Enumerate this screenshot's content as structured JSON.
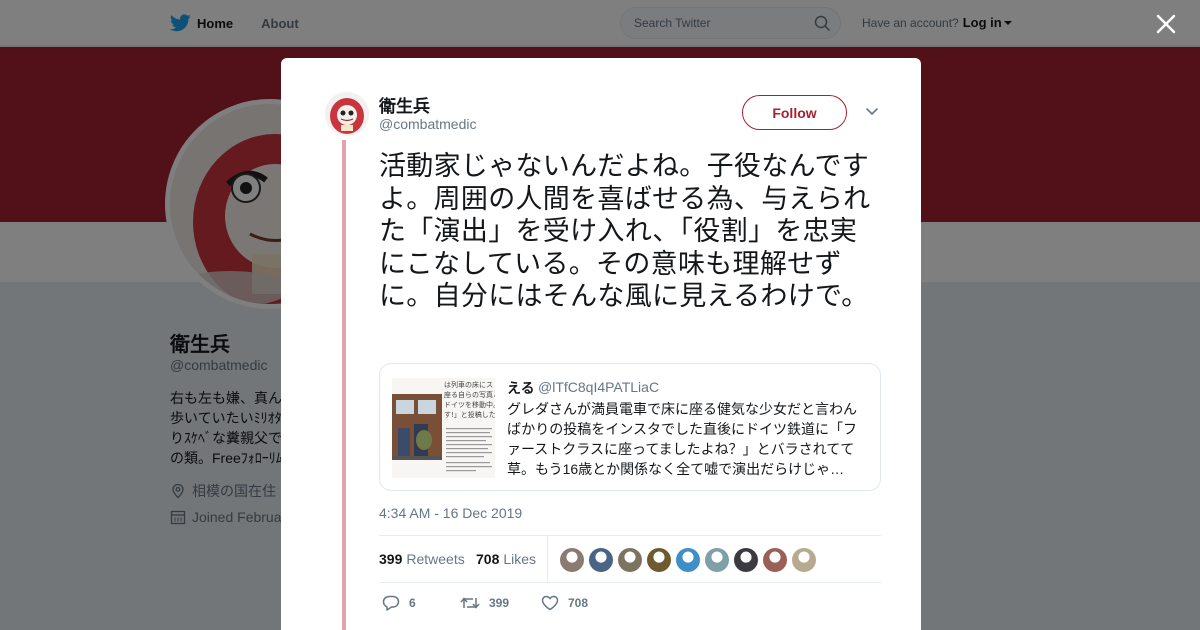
{
  "topbar": {
    "home_label": "Home",
    "about_label": "About",
    "search_placeholder": "Search Twitter",
    "have_account": "Have an account?",
    "login_label": "Log in"
  },
  "profile": {
    "name": "衛生兵",
    "handle": "@combatmedic",
    "bio_lines": [
      "右も左も嫌、真ん",
      "歩いていたいﾐﾘｵﾀ",
      "りｽｹﾍﾞな糞親父で",
      "の類。Freeﾌｫﾛｰﾘﾑ"
    ],
    "location": "相模の国在住",
    "joined": "Joined February"
  },
  "tweet": {
    "author_name": "衛生兵",
    "author_handle": "@combatmedic",
    "follow_label": "Follow",
    "text": "活動家じゃないんだよね。子役なんですよ。周囲の人間を喜ばせる為、与えられた「演出」を受け入れ、「役割」を忠実にこなしている。その意味も理解せずに。自分にはそんな風に見えるわけで。",
    "quoted": {
      "name": "える",
      "handle": "@lTfC8qI4PATLiaC",
      "text": "グレダさんが満員電車で床に座る健気な少女だと言わんばかりの投稿をインスタでした直後にドイツ鉄道に「ファーストクラスに座ってましたよね？」とバラされてて草。もう16歳とか関係なく全て嘘で演出だらけじゃ…",
      "image_text": [
        "は列車の床にス",
        "座る自らの写真と",
        "ドイツを移動中。",
        "す!」と投稿した"
      ]
    },
    "timestamp": "4:34 AM - 16 Dec 2019",
    "retweets_count": "399",
    "retweets_label": "Retweets",
    "likes_count": "708",
    "likes_label": "Likes",
    "likers_colors": [
      "#8a7a72",
      "#4a6486",
      "#7b7560",
      "#6e5a2e",
      "#3d8fc9",
      "#7fa0a8",
      "#3a3a40",
      "#9a6058",
      "#b8aa90"
    ],
    "reply_count": "6",
    "retweet_action_count": "399",
    "like_action_count": "708"
  },
  "colors": {
    "accent": "#a42230",
    "thread_line": "#e8a2ab",
    "twitter_blue": "#1da1f2"
  },
  "icons": [
    "twitter-bird-icon",
    "search-icon",
    "close-icon",
    "chevron-down-icon",
    "location-pin-icon",
    "calendar-icon",
    "reply-icon",
    "retweet-icon",
    "like-icon"
  ]
}
